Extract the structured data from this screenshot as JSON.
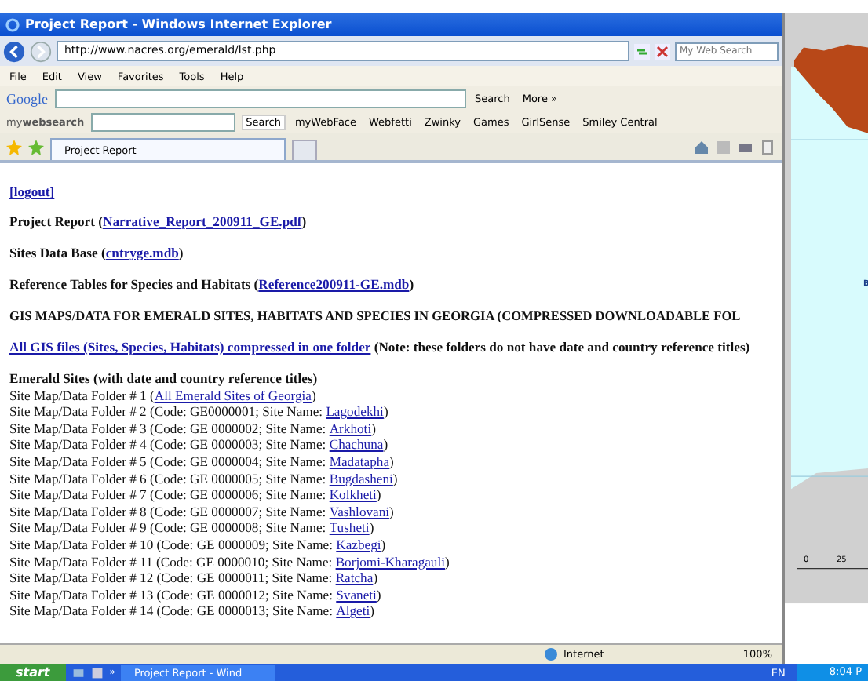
{
  "window": {
    "title": "Project Report - Windows Internet Explorer"
  },
  "address_bar": {
    "url": "http://www.nacres.org/emerald/lst.php",
    "search_placeholder": "My Web Search"
  },
  "menu": [
    "File",
    "Edit",
    "View",
    "Favorites",
    "Tools",
    "Help"
  ],
  "google_toolbar": {
    "logo": "Google",
    "search_button": "Search",
    "more": "More »"
  },
  "mywebsearch_toolbar": {
    "logo_left": "my",
    "logo_bold": "websearch",
    "search_button": "Search",
    "items": [
      "myWebFace",
      "Webfetti",
      "Zwinky",
      "Games",
      "GirlSense",
      "Smiley Central"
    ]
  },
  "tabs": [
    {
      "label": "Project Report",
      "selected": true
    }
  ],
  "page": {
    "logout": "[logout]",
    "lines": [
      {
        "kind": "link_line",
        "prefix": "Project Report (",
        "link": "Narrative_Report_200911_GE.pdf",
        "suffix": ")"
      },
      {
        "kind": "link_line",
        "prefix": "Sites Data Base (",
        "link": "cntryge.mdb",
        "suffix": ")"
      },
      {
        "kind": "link_line",
        "prefix": "Reference Tables for Species and Habitats (",
        "link": "Reference200911-GE.mdb",
        "suffix": ")"
      },
      {
        "kind": "heading",
        "text": "GIS MAPS/DATA FOR EMERALD SITES, HABITATS AND SPECIES IN GEORGIA (COMPRESSED DOWNLOADABLE FOL"
      },
      {
        "kind": "link_first",
        "link": "All GIS files (Sites, Species, Habitats) compressed in one folder",
        "suffix": " (Note: these folders do not have date and country reference titles)"
      }
    ],
    "sites_heading": "Emerald Sites (with date and country reference titles)",
    "sites": [
      {
        "prefix": "Site Map/Data Folder # 1 (",
        "link": "All Emerald Sites of Georgia",
        "suffix": ")"
      },
      {
        "prefix": "Site Map/Data Folder # 2 (Code: GE0000001; Site Name: ",
        "link": "Lagodekhi",
        "suffix": ")"
      },
      {
        "prefix": "Site Map/Data Folder # 3 (Code: GE 0000002; Site Name: ",
        "link": "Arkhoti",
        "suffix": ")"
      },
      {
        "prefix": "Site Map/Data Folder # 4 (Code: GE 0000003; Site Name: ",
        "link": "Chachuna",
        "suffix": ")"
      },
      {
        "prefix": "Site Map/Data Folder # 5 (Code: GE 0000004; Site Name: ",
        "link": "Madatapha",
        "suffix": ")"
      },
      {
        "prefix": "Site Map/Data Folder # 6 (Code: GE 0000005; Site Name: ",
        "link": "Bugdasheni",
        "suffix": ")"
      },
      {
        "prefix": "Site Map/Data Folder # 7 (Code: GE 0000006; Site Name: ",
        "link": "Kolkheti",
        "suffix": ")"
      },
      {
        "prefix": "Site Map/Data Folder # 8 (Code: GE 0000007; Site Name: ",
        "link": "Vashlovani",
        "suffix": ")"
      },
      {
        "prefix": "Site Map/Data Folder # 9 (Code: GE 0000008; Site Name: ",
        "link": "Tusheti",
        "suffix": ")"
      },
      {
        "prefix": "Site Map/Data Folder # 10 (Code: GE 0000009; Site Name: ",
        "link": "Kazbegi",
        "suffix": ")"
      },
      {
        "prefix": "Site Map/Data Folder # 11 (Code: GE 0000010; Site Name: ",
        "link": "Borjomi-Kharagauli",
        "suffix": ")"
      },
      {
        "prefix": "Site Map/Data Folder # 12 (Code: GE 0000011; Site Name: ",
        "link": "Ratcha",
        "suffix": ")"
      },
      {
        "prefix": "Site Map/Data Folder # 13 (Code: GE 0000012; Site Name: ",
        "link": "Svaneti",
        "suffix": ")"
      },
      {
        "prefix": "Site Map/Data Folder # 14 (Code: GE 0000013; Site Name: ",
        "link": "Algeti",
        "suffix": ")"
      }
    ]
  },
  "status_bar": {
    "zone": "Internet",
    "zoom": "100%"
  },
  "map": {
    "label": "B",
    "scale": [
      "0",
      "25"
    ]
  },
  "taskbar": {
    "start": "start",
    "chevron": "»",
    "task": "Project Report - Wind",
    "language": "EN",
    "clock": "8:04 P"
  }
}
